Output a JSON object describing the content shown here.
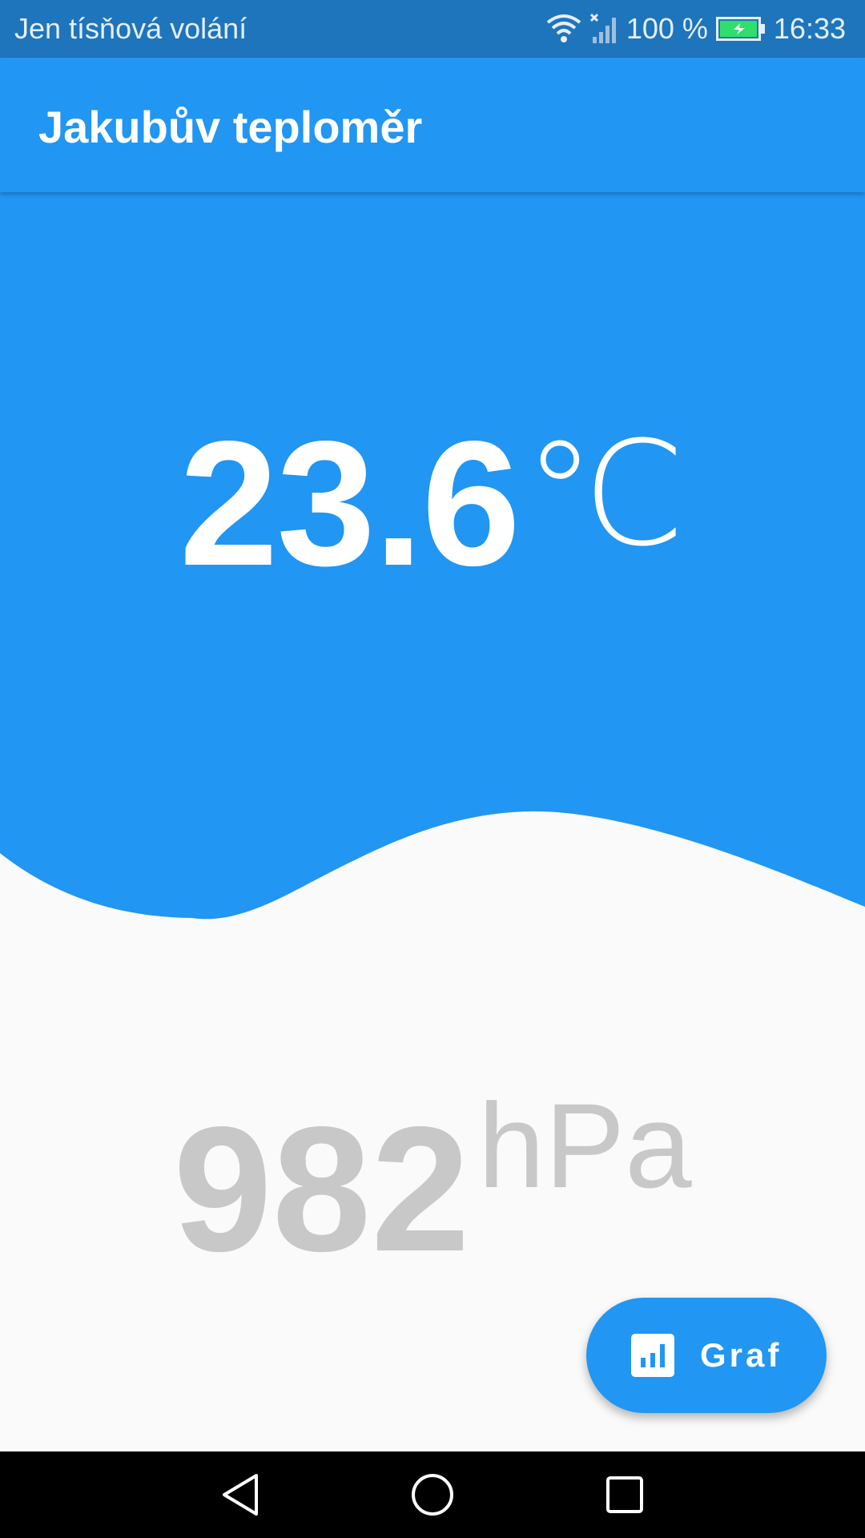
{
  "status_bar": {
    "carrier_text": "Jen tísňová volání",
    "battery_text": "100 %",
    "time": "16:33",
    "icons": [
      "wifi-icon",
      "no-signal-icon",
      "battery-charging-icon"
    ]
  },
  "app_bar": {
    "title": "Jakubův teploměr"
  },
  "temperature": {
    "value": "23.6",
    "unit": "℃"
  },
  "pressure": {
    "value": "982",
    "unit": "hPa"
  },
  "fab": {
    "label": "Graf",
    "icon": "bar-chart-icon"
  },
  "nav_bar": {
    "buttons": [
      "back-icon",
      "home-icon",
      "recents-icon"
    ]
  },
  "colors": {
    "primary": "#2196f3",
    "status_bar": "#1e75bc",
    "background": "#fafafa",
    "pressure_text": "#c8c8c8",
    "battery_fill": "#2ee06b"
  }
}
